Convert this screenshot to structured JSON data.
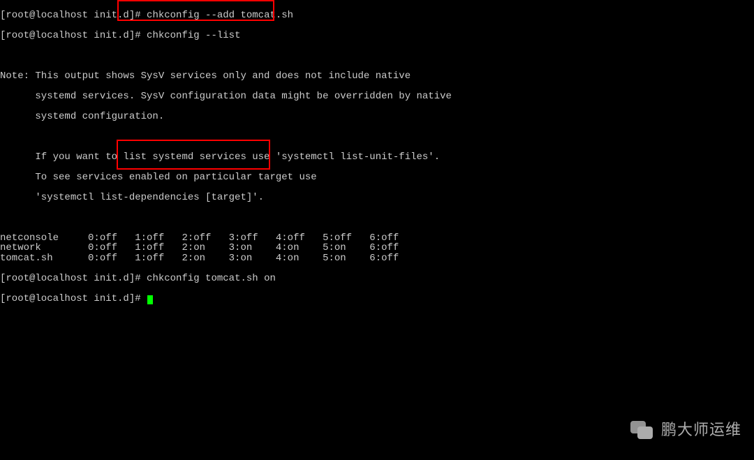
{
  "prompt": "[root@localhost init.d]# ",
  "commands": {
    "cmd1": "chkconfig --add tomcat.sh",
    "cmd2": "chkconfig --list",
    "cmd3": "chkconfig tomcat.sh on",
    "cmd4": ""
  },
  "note": {
    "l1": "Note: This output shows SysV services only and does not include native",
    "l2": "      systemd services. SysV configuration data might be overridden by native",
    "l3": "      systemd configuration.",
    "l4": "      If you want to list systemd services use 'systemctl list-unit-files'.",
    "l5": "      To see services enabled on particular target use",
    "l6": "      'systemctl list-dependencies [target]'."
  },
  "services": [
    {
      "name": "netconsole",
      "levels": [
        "0:off",
        "1:off",
        "2:off",
        "3:off",
        "4:off",
        "5:off",
        "6:off"
      ]
    },
    {
      "name": "network",
      "levels": [
        "0:off",
        "1:off",
        "2:on",
        "3:on",
        "4:on",
        "5:on",
        "6:off"
      ]
    },
    {
      "name": "tomcat.sh",
      "levels": [
        "0:off",
        "1:off",
        "2:on",
        "3:on",
        "4:on",
        "5:on",
        "6:off"
      ]
    }
  ],
  "watermark": "鹏大师运维"
}
